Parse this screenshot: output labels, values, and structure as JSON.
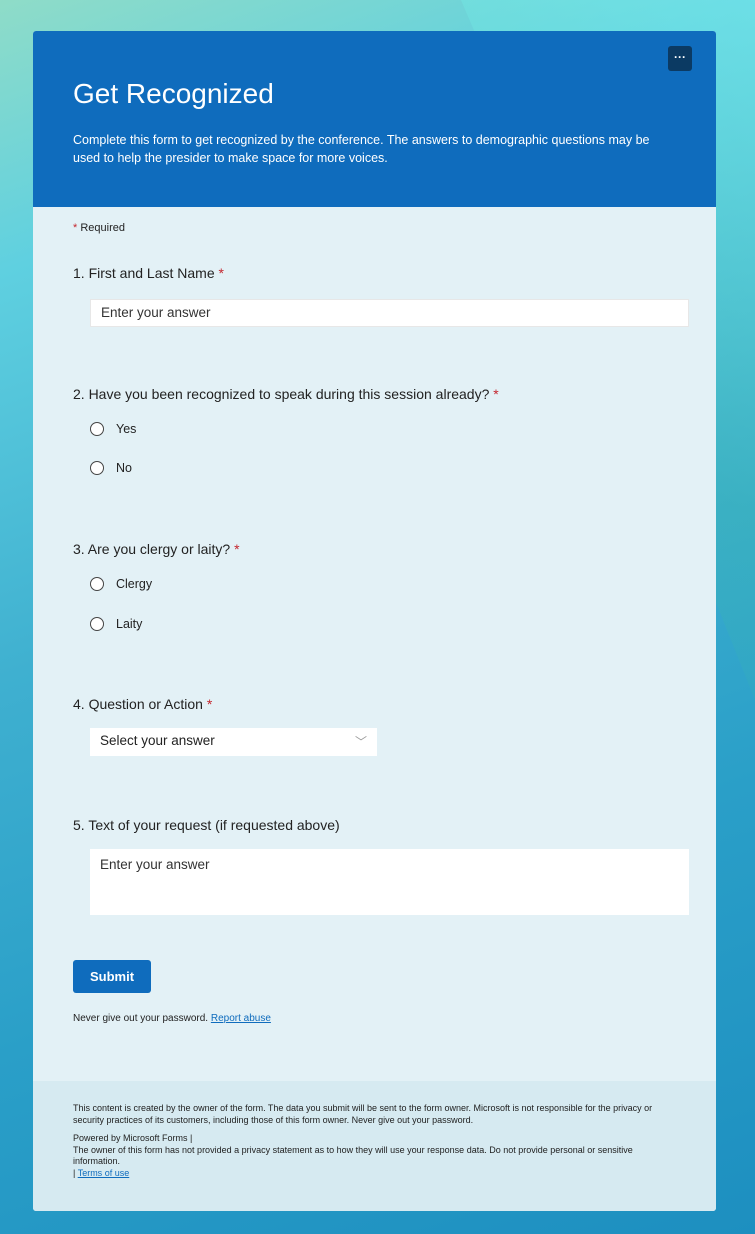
{
  "header": {
    "title": "Get Recognized",
    "description": "Complete this form to get recognized by the conference. The answers to demographic questions may be used to help the presider to make space for more voices.",
    "more_label": "···"
  },
  "required_note": {
    "star": "*",
    "label": "Required"
  },
  "questions": [
    {
      "label": "1. First and Last Name",
      "star": "*",
      "placeholder": "Enter your answer"
    },
    {
      "label": "2. Have you been recognized to speak during this session already?",
      "star": "*",
      "options": [
        "Yes",
        "No"
      ]
    },
    {
      "label": "3. Are you clergy or laity?",
      "star": "*",
      "options": [
        "Clergy",
        "Laity"
      ]
    },
    {
      "label": "4. Question or Action",
      "star": "*",
      "placeholder": "Select your answer",
      "chevron": "﹀"
    },
    {
      "label": "5. Text of your request (if requested above)",
      "placeholder": "Enter your answer"
    }
  ],
  "submit_label": "Submit",
  "password_note": {
    "text": "Never give out your password.",
    "link": "Report abuse"
  },
  "footer": {
    "disclaimer": "This content is created by the owner of the form. The data you submit will be sent to the form owner. Microsoft is not responsible for the privacy or security practices of its customers, including those of this form owner. Never give out your password.",
    "powered": "Powered by Microsoft Forms |",
    "privacy": "The owner of this form has not provided a privacy statement as to how they will use your response data. Do not provide personal or sensitive information.",
    "terms_prefix": "| ",
    "terms_link": "Terms of use"
  },
  "colors": {
    "accent": "#0f6cbd",
    "required": "#c4262e"
  }
}
